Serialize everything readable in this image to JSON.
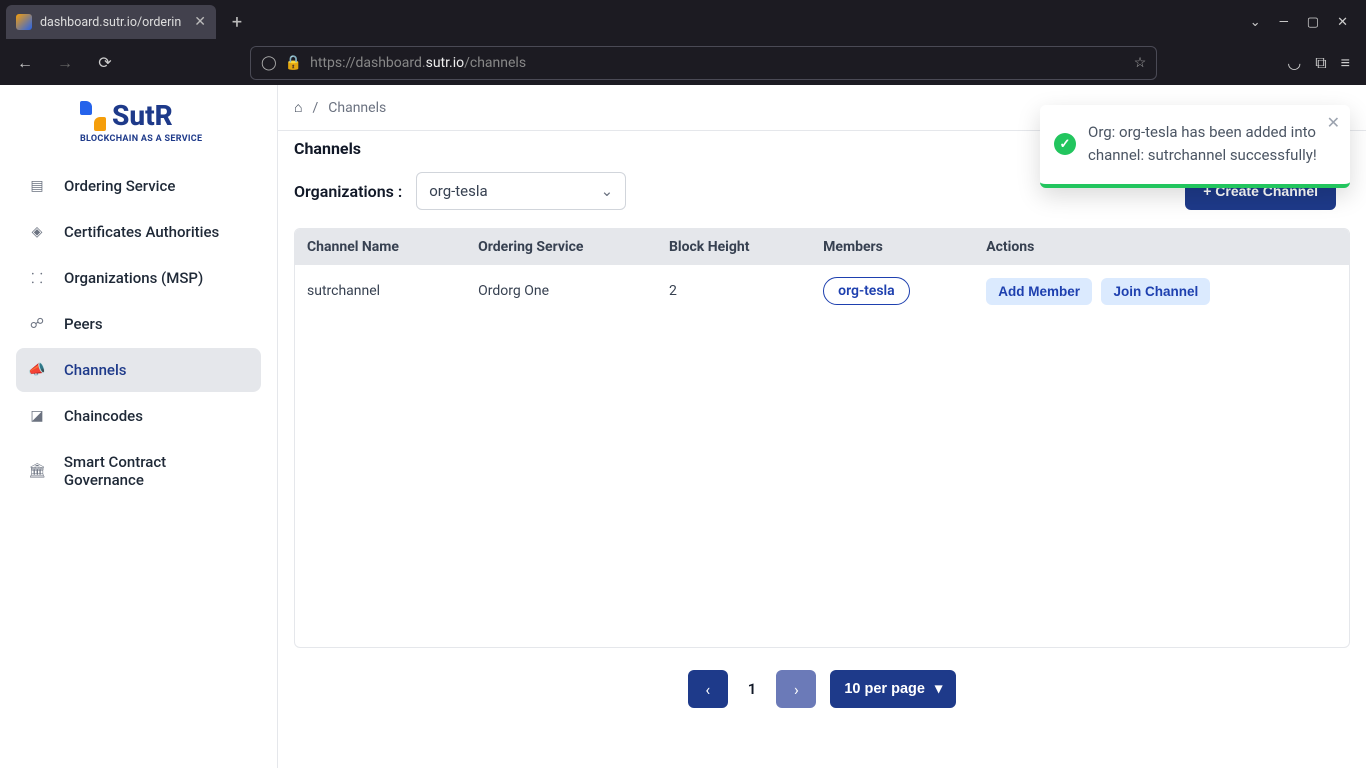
{
  "browser": {
    "tab_title": "dashboard.sutr.io/orderin",
    "url_prefix": "https://",
    "url_host_muted": "dashboard.",
    "url_host_bold": "sutr.io",
    "url_path": "/channels"
  },
  "logo": {
    "text": "SutR",
    "sub": "BLOCKCHAIN AS A SERVICE"
  },
  "sidebar": {
    "items": [
      {
        "label": "Ordering Service"
      },
      {
        "label": "Certificates Authorities"
      },
      {
        "label": "Organizations (MSP)"
      },
      {
        "label": "Peers"
      },
      {
        "label": "Channels"
      },
      {
        "label": "Chaincodes"
      },
      {
        "label": "Smart Contract Governance"
      }
    ]
  },
  "breadcrumb": {
    "sep": "/",
    "current": "Channels"
  },
  "page": {
    "title": "Channels"
  },
  "filter": {
    "label": "Organizations :",
    "selected": "org-tesla"
  },
  "create_btn": "+   Create Channel",
  "table": {
    "headers": {
      "c1": "Channel Name",
      "c2": "Ordering Service",
      "c3": "Block Height",
      "c4": "Members",
      "c5": "Actions"
    },
    "rows": [
      {
        "name": "sutrchannel",
        "ordering": "Ordorg One",
        "height": "2",
        "members": [
          "org-tesla"
        ]
      }
    ]
  },
  "actions": {
    "add_member": "Add Member",
    "join_channel": "Join Channel"
  },
  "pagination": {
    "page": "1",
    "size_label": "10 per page"
  },
  "toast": {
    "message": "Org: org-tesla has been added into channel: sutrchannel successfully!"
  }
}
